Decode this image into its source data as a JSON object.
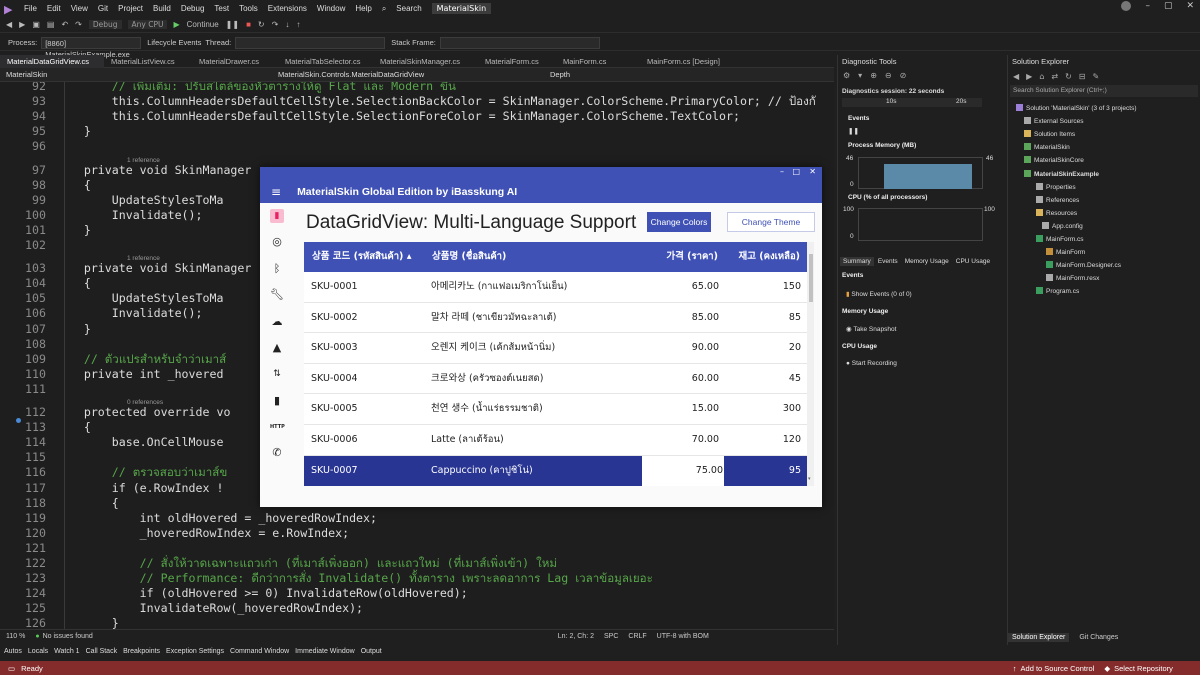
{
  "menu": {
    "items": [
      "File",
      "Edit",
      "View",
      "Git",
      "Project",
      "Build",
      "Debug",
      "Test",
      "Tools",
      "Extensions",
      "Window",
      "Help"
    ],
    "search": "Search",
    "solution_badge": "MaterialSkin"
  },
  "toolbar": {
    "config": "Debug",
    "platform": "Any CPU",
    "continue": "Continue"
  },
  "process_bar": {
    "process_label": "Process:",
    "process_value": "[8860] MaterialSkinExample.exe",
    "lifecycle": "Lifecycle Events",
    "thread_label": "Thread:",
    "stack_label": "Stack Frame:"
  },
  "doc_tabs": [
    "MaterialDataGridView.cs",
    "MaterialListView.cs",
    "MaterialDrawer.cs",
    "MaterialTabSelector.cs",
    "MaterialSkinManager.cs",
    "MaterialForm.cs",
    "MainForm.cs",
    "MainForm.cs [Design]"
  ],
  "nav_bar": {
    "project": "MaterialSkin",
    "class": "MaterialSkin.Controls.MaterialDataGridView",
    "member": "Depth"
  },
  "code_lines": [
    {
      "n": "92",
      "t": "            // เพิ่มเติม: ปรับสไตล์ของหัวตารางให้ดู Flat และ Modern ขึ้น"
    },
    {
      "n": "93",
      "t": "            this.ColumnHeadersDefaultCellStyle.SelectionBackColor = SkinManager.ColorScheme.PrimaryColor; // ป้องกั"
    },
    {
      "n": "94",
      "t": "            this.ColumnHeadersDefaultCellStyle.SelectionForeColor = SkinManager.ColorScheme.TextColor;"
    },
    {
      "n": "95",
      "t": "        }"
    },
    {
      "n": "96",
      "t": ""
    },
    {
      "n": "97",
      "t": "        private void SkinManager"
    },
    {
      "n": "98",
      "t": "        {"
    },
    {
      "n": "99",
      "t": "            UpdateStylesToMa"
    },
    {
      "n": "100",
      "t": "            Invalidate();"
    },
    {
      "n": "101",
      "t": "        }"
    },
    {
      "n": "102",
      "t": ""
    },
    {
      "n": "103",
      "t": "        private void SkinManager"
    },
    {
      "n": "104",
      "t": "        {"
    },
    {
      "n": "105",
      "t": "            UpdateStylesToMa"
    },
    {
      "n": "106",
      "t": "            Invalidate();"
    },
    {
      "n": "107",
      "t": "        }"
    },
    {
      "n": "108",
      "t": ""
    },
    {
      "n": "109",
      "t": "        // ตัวแปรสำหรับจำว่าเมาส์"
    },
    {
      "n": "110",
      "t": "        private int _hovered"
    },
    {
      "n": "111",
      "t": ""
    },
    {
      "n": "112",
      "t": "        protected override vo"
    },
    {
      "n": "113",
      "t": "        {"
    },
    {
      "n": "114",
      "t": "            base.OnCellMouse"
    },
    {
      "n": "115",
      "t": ""
    },
    {
      "n": "116",
      "t": "            // ตรวจสอบว่าเมาส์ข"
    },
    {
      "n": "117",
      "t": "            if (e.RowIndex !"
    },
    {
      "n": "118",
      "t": "            {"
    },
    {
      "n": "119",
      "t": "                int oldHovered = _hoveredRowIndex;"
    },
    {
      "n": "120",
      "t": "                _hoveredRowIndex = e.RowIndex;"
    },
    {
      "n": "121",
      "t": ""
    },
    {
      "n": "122",
      "t": "                // สั่งให้วาดเฉพาะแถวเก่า (ที่เมาส์เพิ่งออก) และแถวใหม่ (ที่เมาส์เพิ่งเข้า) ใหม่"
    },
    {
      "n": "123",
      "t": "                // Performance: ดีกว่าการสั่ง Invalidate() ทั้งตาราง เพราะลดอาการ Lag เวลาข้อมูลเยอะ"
    },
    {
      "n": "124",
      "t": "                if (oldHovered >= 0) InvalidateRow(oldHovered);"
    },
    {
      "n": "125",
      "t": "                InvalidateRow(_hoveredRowIndex);"
    },
    {
      "n": "126",
      "t": "            }"
    }
  ],
  "code_refs": {
    "r1": "1 reference",
    "r2": "1 reference",
    "r3": "0 references"
  },
  "editor_status": {
    "zoom": "110 %",
    "issues": "No issues found",
    "pos": "Ln: 2, Ch: 2",
    "spc": "SPC",
    "crlf": "CRLF",
    "enc": "UTF-8 with BOM"
  },
  "bottom_tabs": [
    "Autos",
    "Locals",
    "Watch 1",
    "Call Stack",
    "Breakpoints",
    "Exception Settings",
    "Command Window",
    "Immediate Window",
    "Output"
  ],
  "status": {
    "ready": "Ready",
    "source_control": "Add to Source Control",
    "repo": "Select Repository"
  },
  "diagnostics": {
    "title": "Diagnostic Tools",
    "session": "Diagnostics session: 22 seconds",
    "tick1": "10s",
    "tick2": "20s",
    "events": "Events",
    "process_memory": "Process Memory (MB)",
    "mem_max": "46",
    "mem_min": "0",
    "cpu": "CPU (% of all processors)",
    "cpu_max": "100",
    "cpu_min": "0",
    "tabs": [
      "Summary",
      "Events",
      "Memory Usage",
      "CPU Usage"
    ],
    "events_head": "Events",
    "show_events": "Show Events (0 of 0)",
    "memory_head": "Memory Usage",
    "take_snapshot": "Take Snapshot",
    "cpu_head": "CPU Usage",
    "start_recording": "Start Recording"
  },
  "solution_explorer": {
    "title": "Solution Explorer",
    "search": "Search Solution Explorer (Ctrl+;)",
    "nodes": [
      "Solution 'MaterialSkin' (3 of 3 projects)",
      "External Sources",
      "Solution Items",
      "MaterialSkin",
      "MaterialSkinCore",
      "MaterialSkinExample",
      "Properties",
      "References",
      "Resources",
      "App.config",
      "MainForm.cs",
      "MainForm",
      "MainForm.Designer.cs",
      "MainForm.resx",
      "Program.cs"
    ],
    "tabs": [
      "Solution Explorer",
      "Git Changes"
    ]
  },
  "material_window": {
    "title": "MaterialSkin Global Edition by iBasskung AI",
    "heading": "DataGridView: Multi-Language Support",
    "change_colors": "Change Colors",
    "change_theme": "Change Theme",
    "primary_color": "#3f51b5",
    "selected_row_color": "#283593",
    "columns": [
      "상품 코드 (รหัสสินค้า) ▴",
      "상품명 (ชื่อสินค้า)",
      "가격 (ราคา)",
      "재고 (คงเหลือ)"
    ],
    "rows": [
      [
        "SKU-0001",
        "아메리카노 (กาแฟอเมริกาโน่เย็น)",
        "65.00",
        "150"
      ],
      [
        "SKU-0002",
        "말차 라떼 (ชาเขียวมัทฉะลาเต้)",
        "85.00",
        "85"
      ],
      [
        "SKU-0003",
        "오렌지 케이크 (เค้กส้มหน้านิ่ม)",
        "90.00",
        "20"
      ],
      [
        "SKU-0004",
        "크로와상 (ครัวซองต์เนยสด)",
        "60.00",
        "45"
      ],
      [
        "SKU-0005",
        "천연 생수 (น้ำแร่ธรรมชาติ)",
        "15.00",
        "300"
      ],
      [
        "SKU-0006",
        "Latte (ลาเต้ร้อน)",
        "70.00",
        "120"
      ],
      [
        "SKU-0007",
        "Cappuccino (คาปูชิโน่)",
        "75.00",
        "95"
      ]
    ],
    "sidebar_icons": [
      "chart-icon",
      "gps-icon",
      "bluetooth-icon",
      "wrench-icon",
      "cloud-upload-icon",
      "warning-icon",
      "swap-icon",
      "bookmark-icon",
      "http-icon",
      "phone-icon"
    ],
    "http_text": "HTTP"
  }
}
